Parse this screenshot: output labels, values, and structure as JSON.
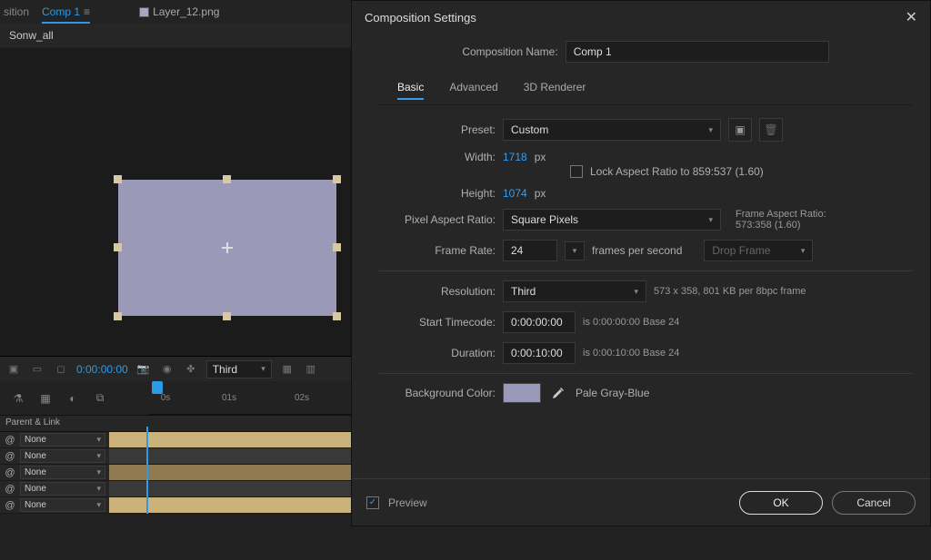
{
  "tabs": {
    "comp": "Comp 1",
    "layer": "Layer_12.png",
    "other": "sition"
  },
  "panel": {
    "name": "Sonw_all"
  },
  "controlbar": {
    "time": "0:00:00:00",
    "resolution": "Third"
  },
  "timeline": {
    "header": "Parent & Link",
    "times": [
      "0s",
      "01s",
      "02s"
    ],
    "rows": [
      {
        "val": "None"
      },
      {
        "val": "None"
      },
      {
        "val": "None"
      },
      {
        "val": "None"
      },
      {
        "val": "None"
      }
    ]
  },
  "dialog": {
    "title": "Composition Settings",
    "compname_label": "Composition Name:",
    "compname": "Comp 1",
    "tabs": {
      "basic": "Basic",
      "advanced": "Advanced",
      "renderer": "3D Renderer"
    },
    "preset_label": "Preset:",
    "preset": "Custom",
    "width_label": "Width:",
    "width": "1718",
    "height_label": "Height:",
    "height": "1074",
    "px": "px",
    "lock_label": "Lock Aspect Ratio to 859:537 (1.60)",
    "par_label": "Pixel Aspect Ratio:",
    "par": "Square Pixels",
    "far_label": "Frame Aspect Ratio:",
    "far_value": "573:358 (1.60)",
    "fps_label": "Frame Rate:",
    "fps": "24",
    "fps_unit": "frames per second",
    "dropframe": "Drop Frame",
    "res_label": "Resolution:",
    "res": "Third",
    "res_info": "573 x 358, 801 KB per 8bpc frame",
    "start_label": "Start Timecode:",
    "start": "0:00:00:00",
    "start_info": "is 0:00:00:00  Base 24",
    "dur_label": "Duration:",
    "dur": "0:00:10:00",
    "dur_info": "is 0:00:10:00  Base 24",
    "bgc_label": "Background Color:",
    "bgc_name": "Pale Gray-Blue",
    "preview": "Preview",
    "ok": "OK",
    "cancel": "Cancel"
  }
}
